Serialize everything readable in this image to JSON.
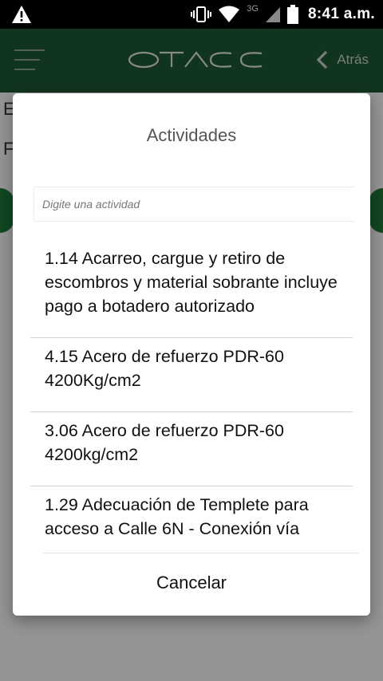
{
  "status_bar": {
    "network_type": "3G",
    "time": "8:41 a.m."
  },
  "header": {
    "logo_text": "OTACC",
    "back_label": "Atrás"
  },
  "background": {
    "letters": [
      "E",
      "F"
    ]
  },
  "dialog": {
    "title": "Actividades",
    "search_placeholder": "Digite una actividad",
    "items": [
      {
        "label": "1.14 Acarreo, cargue y retiro de escombros y material sobrante incluye pago a botadero autorizado"
      },
      {
        "label": "4.15 Acero de refuerzo PDR-60 4200Kg/cm2"
      },
      {
        "label": "3.06 Acero de refuerzo PDR-60 4200kg/cm2"
      },
      {
        "label": "1.29 Adecuación de Templete para acceso a Calle 6N - Conexión vía"
      }
    ],
    "cancel_label": "Cancelar"
  }
}
